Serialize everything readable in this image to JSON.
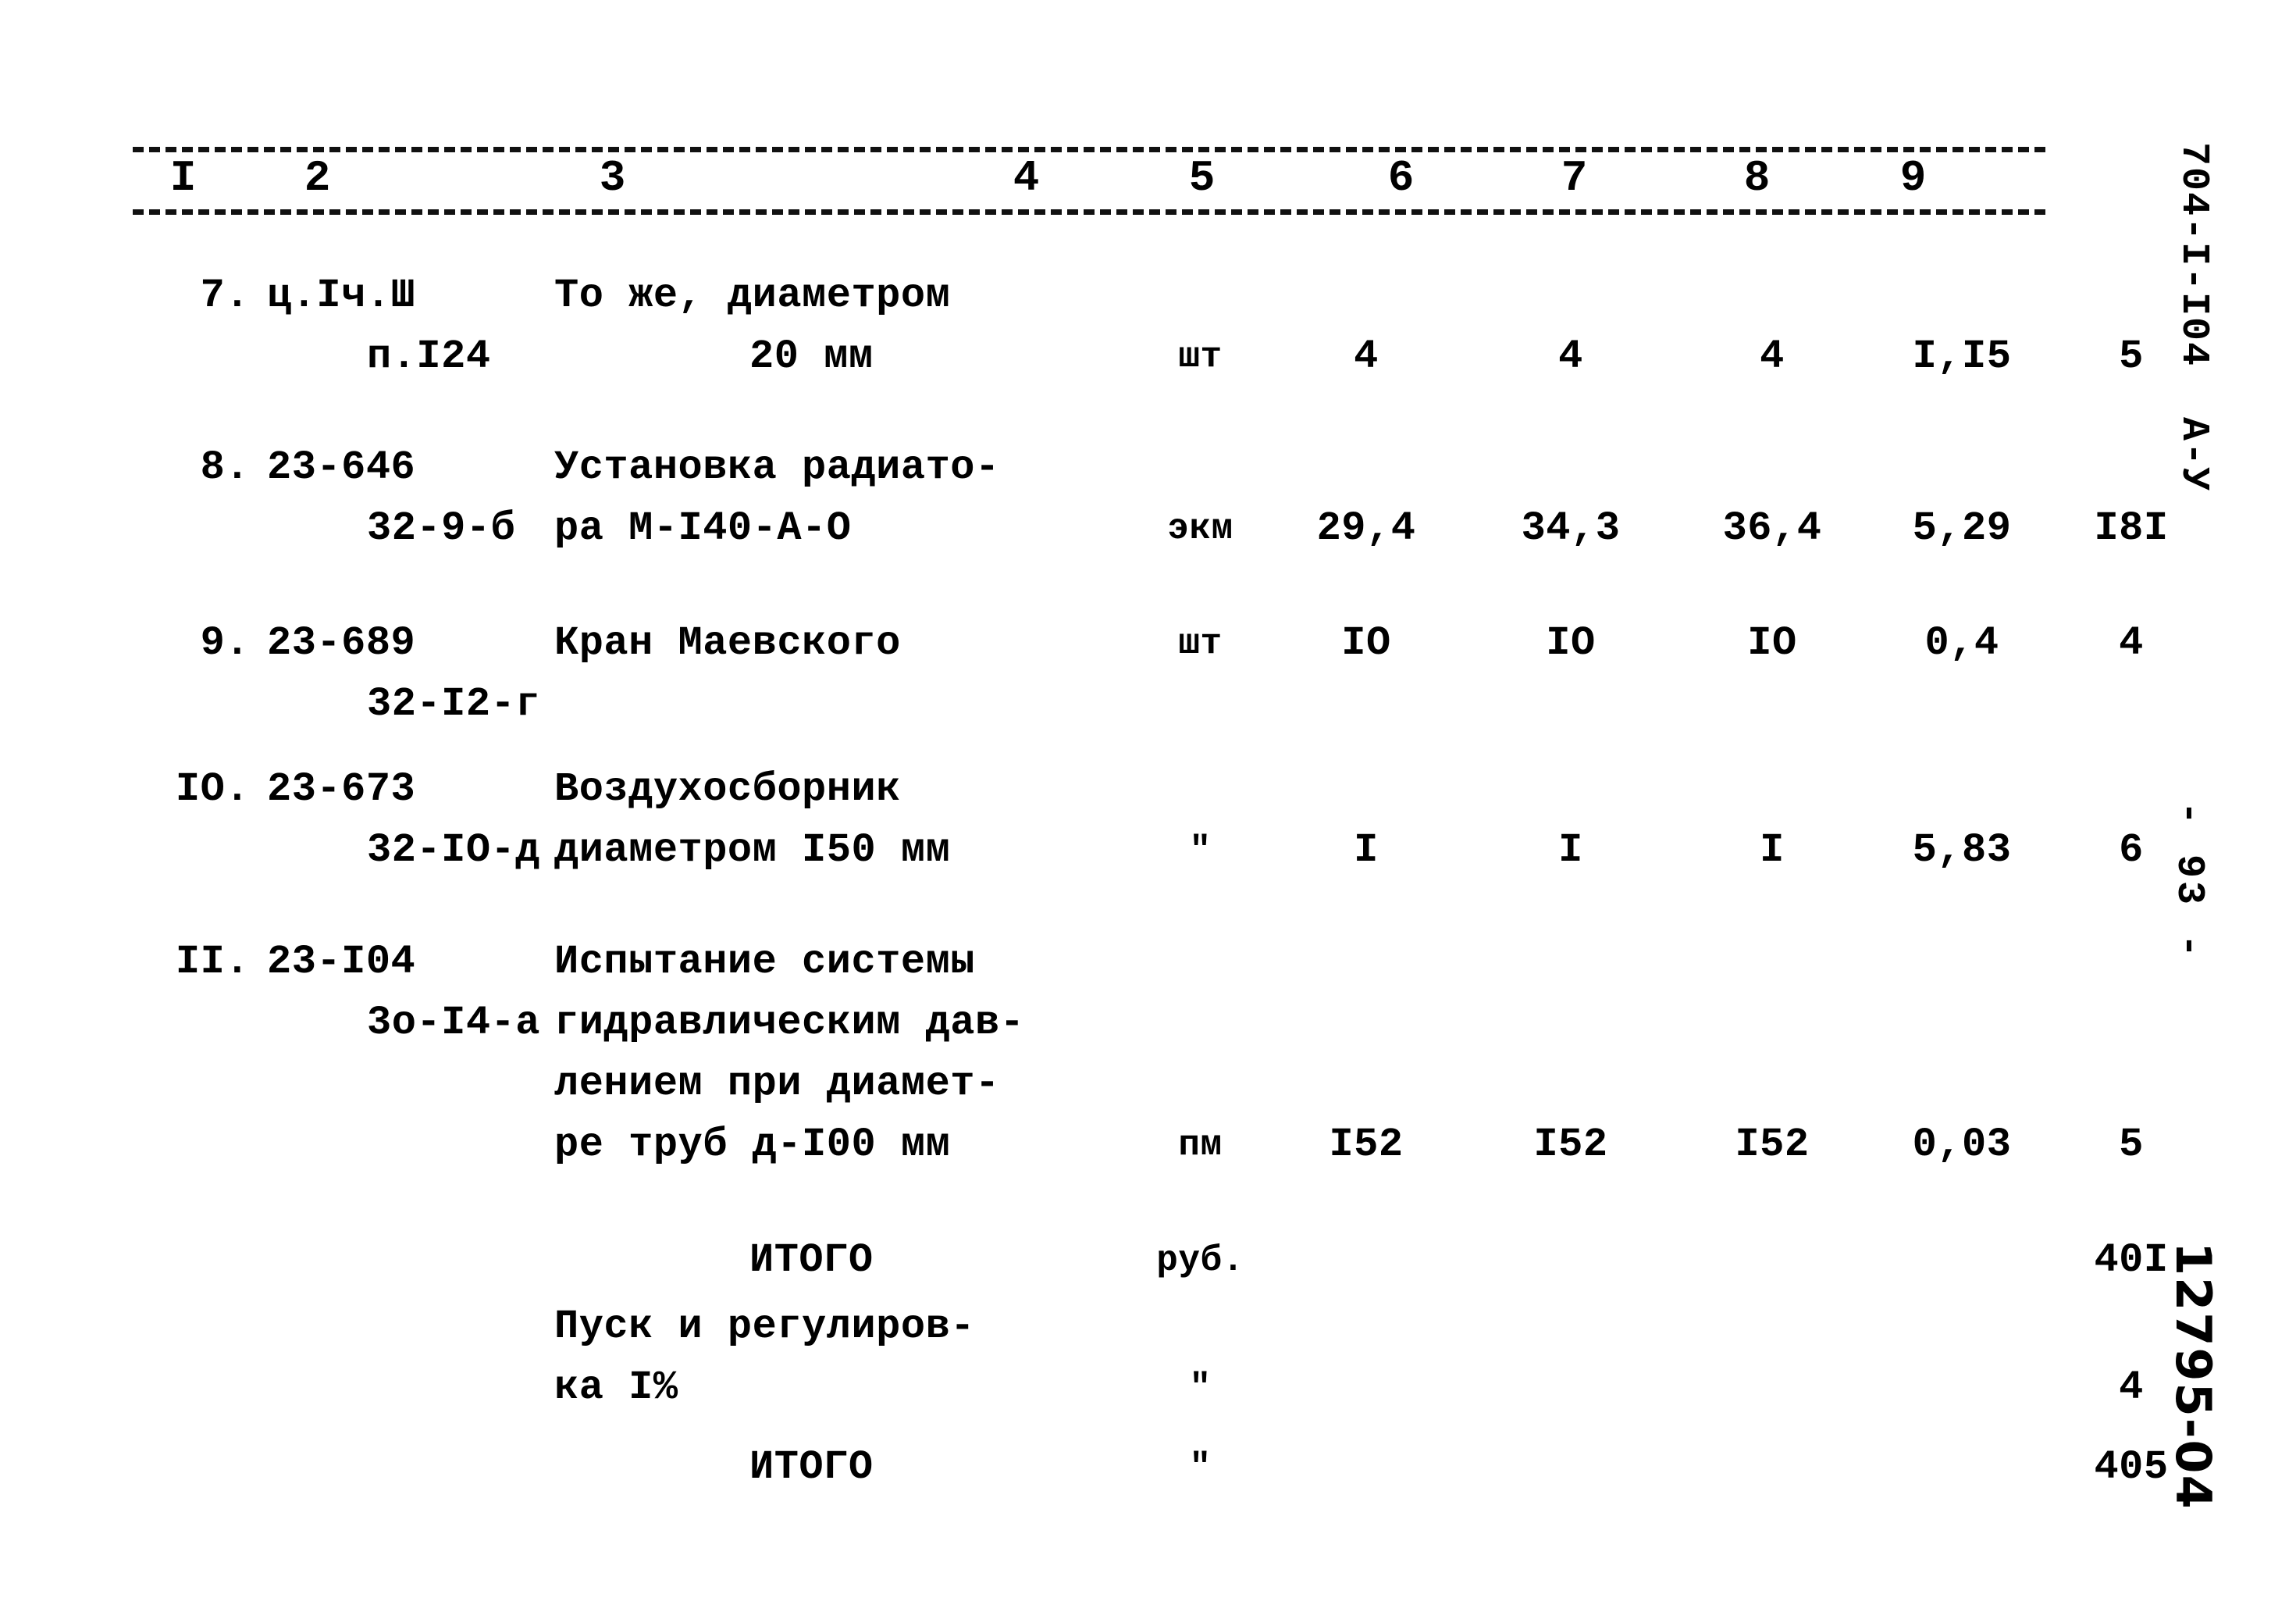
{
  "document": {
    "doc_code": "704-I-I04  А-У",
    "page_number": "- 93 -",
    "archive_stamp": "12795-04"
  },
  "table": {
    "column_numbers": [
      "I",
      "2",
      "3",
      "4",
      "5",
      "6",
      "7",
      "8",
      "9"
    ],
    "rows": [
      {
        "number": "7.",
        "code_lines": [
          "ц.Iч.Ш",
          "п.I24"
        ],
        "description_lines": [
          "То же, диаметром",
          "20 мм"
        ],
        "unit": "шт",
        "v1": "4",
        "v2": "4",
        "v3": "4",
        "v4": "I,I5",
        "v5": "5"
      },
      {
        "number": "8.",
        "code_lines": [
          "23-646",
          "32-9-б"
        ],
        "description_lines": [
          "Установка радиато-",
          "ра М-I40-А-О"
        ],
        "unit": "экм",
        "v1": "29,4",
        "v2": "34,3",
        "v3": "36,4",
        "v4": "5,29",
        "v5": "I8I"
      },
      {
        "number": "9.",
        "code_lines": [
          "23-689",
          "32-I2-г"
        ],
        "description_lines": [
          "Кран Маевского"
        ],
        "unit": "шт",
        "v1": "IO",
        "v2": "IO",
        "v3": "IO",
        "v4": "0,4",
        "v5": "4"
      },
      {
        "number": "IО.",
        "code_lines": [
          "23-673",
          "32-IO-д"
        ],
        "description_lines": [
          "Воздухосборник",
          "диаметром I50 мм"
        ],
        "unit": "\"",
        "v1": "I",
        "v2": "I",
        "v3": "I",
        "v4": "5,83",
        "v5": "6"
      },
      {
        "number": "II.",
        "code_lines": [
          "23-I04",
          "3о-I4-а"
        ],
        "description_lines": [
          "Испытание системы",
          "гидравлическим дав-",
          "лением при диамет-",
          "ре труб д-I00 мм"
        ],
        "unit": "пм",
        "v1": "I52",
        "v2": "I52",
        "v3": "I52",
        "v4": "0,03",
        "v5": "5"
      }
    ],
    "totals": [
      {
        "label": "ИТОГО",
        "unit": "руб.",
        "value": "40I"
      },
      {
        "label_lines": [
          "Пуск и регулиров-",
          "ка I%"
        ],
        "unit": "\"",
        "value": "4"
      },
      {
        "label": "ИТОГО",
        "unit": "\"",
        "value": "405"
      }
    ]
  }
}
